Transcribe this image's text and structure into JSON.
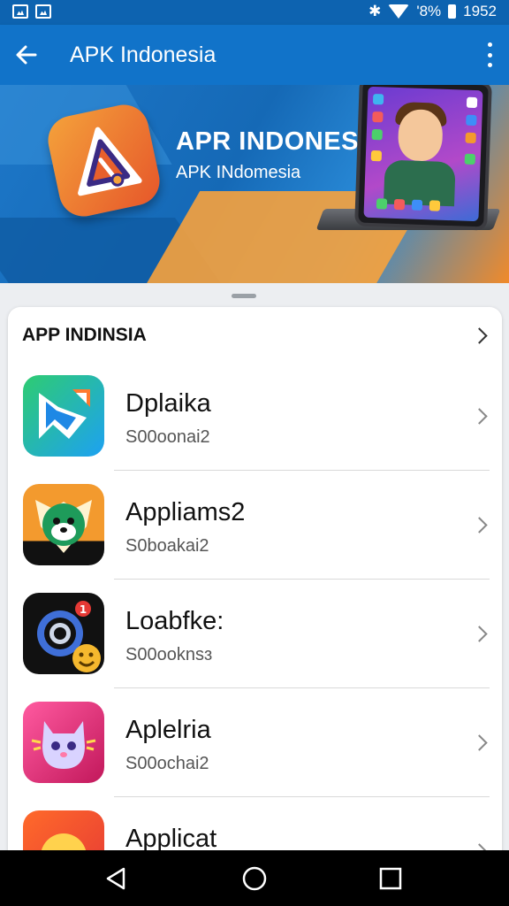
{
  "status_bar": {
    "battery_text": "'8%",
    "time": "1952"
  },
  "app_bar": {
    "title": "APK Indonesia"
  },
  "banner": {
    "headline": "APR INDONESIA",
    "subtitle": "APK INdomesia"
  },
  "section": {
    "title": "APP INDINSIA"
  },
  "apps": [
    {
      "name": "Dplaika",
      "subtitle": "S00oonai2",
      "icon": "map-pin-app-icon"
    },
    {
      "name": "Appliams2",
      "subtitle": "S0boakai2",
      "icon": "dog-face-app-icon"
    },
    {
      "name": "Loabfke:",
      "subtitle": "S00ooknsɜ",
      "icon": "camera-lens-app-icon"
    },
    {
      "name": "Aplelria",
      "subtitle": "S00ochai2",
      "icon": "cat-mascot-app-icon"
    },
    {
      "name": "Applicat",
      "subtitle": "",
      "icon": "orange-circle-app-icon"
    }
  ],
  "colors": {
    "primary": "#1173c9",
    "status": "#0d63b0",
    "accent_orange": "#f08a2a"
  }
}
